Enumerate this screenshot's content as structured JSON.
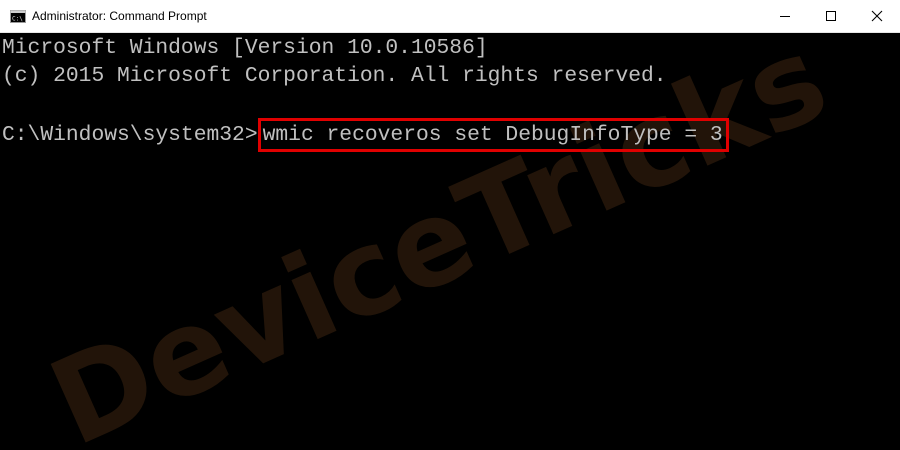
{
  "window": {
    "title": "Administrator: Command Prompt",
    "icon": "command-prompt-icon",
    "controls": [
      "minimize-icon",
      "maximize-icon",
      "close-icon"
    ]
  },
  "console": {
    "lines": [
      "Microsoft Windows [Version 10.0.10586]",
      "(c) 2015 Microsoft Corporation. All rights reserved."
    ],
    "prompt": "C:\\Windows\\system32>",
    "command": "wmic recoveros set DebugInfoType = 3"
  },
  "watermark": {
    "text": "DeviceTricks"
  },
  "colors": {
    "background": "#000000",
    "text": "#c0c0c0",
    "highlight": "#e00000",
    "watermark": "#2a1a08"
  }
}
